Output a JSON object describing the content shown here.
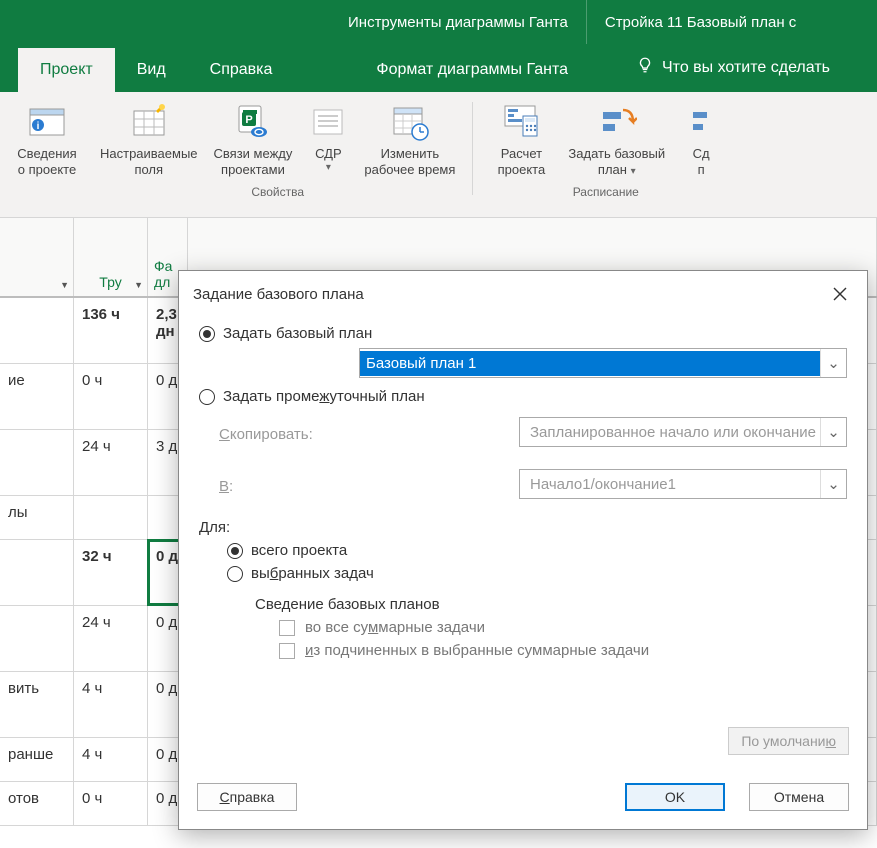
{
  "titlebar": {
    "context_tool": "Инструменты диаграммы Ганта",
    "doc_name": "Стройка 11 Базовый план с"
  },
  "tabs": {
    "project": "Проект",
    "view": "Вид",
    "help": "Справка",
    "format": "Формат диаграммы Ганта",
    "tellme": "Что вы хотите сделать"
  },
  "ribbon": {
    "info_l1": "Сведения",
    "info_l2": "о проекте",
    "customfields_l1": "Настраиваемые",
    "customfields_l2": "поля",
    "links_l1": "Связи между",
    "links_l2": "проектами",
    "wbs": "СДР",
    "changetime_l1": "Изменить",
    "changetime_l2": "рабочее время",
    "calc_l1": "Расчет",
    "calc_l2": "проекта",
    "baseline_l1": "Задать базовый",
    "baseline_l2": "план",
    "move": "Сд",
    "more": "п",
    "group_props": "Свойства",
    "group_sched": "Расписание"
  },
  "sheet": {
    "col1": "",
    "col2": "Тру",
    "col3_l1": "Фа",
    "col3_l2": "дл",
    "rows": [
      {
        "c1": "",
        "c2": "136 ч",
        "c3": "2,3",
        "c3b": "дн",
        "bold": true,
        "short": false
      },
      {
        "c1": "ие",
        "c2": "0 ч",
        "c3": "0 д",
        "short": false
      },
      {
        "c1": "",
        "c2": "24 ч",
        "c3": "3 д",
        "short": false
      },
      {
        "c1": "лы",
        "c2": "",
        "c3": "",
        "short": true
      },
      {
        "c1": "",
        "c2": "32 ч",
        "c3": "0 д",
        "bold": true,
        "sel": true,
        "short": false
      },
      {
        "c1": "",
        "c2": "24 ч",
        "c3": "0 д",
        "short": false
      },
      {
        "c1": "вить",
        "c2": "4 ч",
        "c3": "0 д",
        "short": false
      },
      {
        "c1": "ранше",
        "c2": "4 ч",
        "c3": "0 д",
        "short": true
      },
      {
        "c1": "отов",
        "c2": "0 ч",
        "c3": "0 д",
        "short": true
      }
    ]
  },
  "dialog": {
    "title": "Задание базового плана",
    "opt_set_baseline": "Задать базовый план",
    "baseline_combo": "Базовый план 1",
    "opt_set_interim": "Задать промежуточный план",
    "copy_label": "Скопировать:",
    "copy_combo": "Запланированное начало или окончание",
    "into_label": "В:",
    "into_combo": "Начало1/окончание1",
    "for_label": "Для:",
    "for_entire": "всего проекта",
    "for_selected": "выбранных задач",
    "rollup_label": "Сведение базовых планов",
    "rollup_all": "во все суммарные задачи",
    "rollup_children": "из подчиненных в выбранные суммарные задачи",
    "help_btn": "Справка",
    "default_btn": "По умолчанию",
    "ok_btn": "OK",
    "cancel_btn": "Отмена"
  }
}
